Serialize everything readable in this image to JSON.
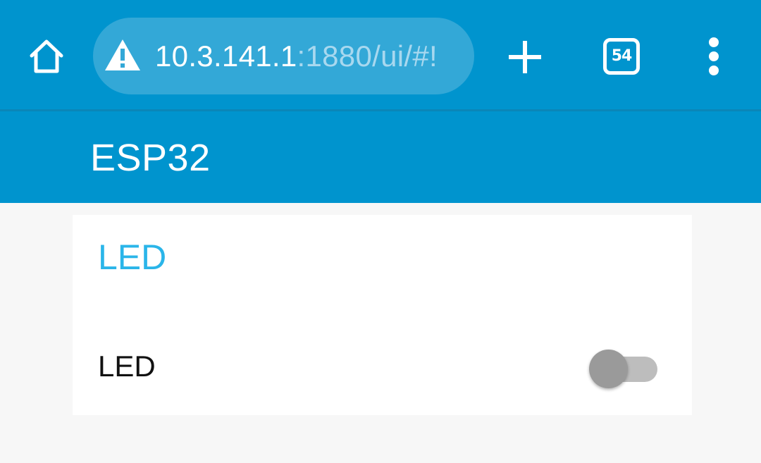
{
  "browser": {
    "url_host": "10.3.141.1",
    "url_rest": ":1880/ui/#!",
    "tab_count": "54",
    "icons": {
      "home": "home-icon",
      "warning": "warning-triangle-icon",
      "new_tab": "plus-icon",
      "tabs": "tab-switcher-icon",
      "menu": "overflow-menu-icon"
    },
    "colors": {
      "bar": "#0094ce",
      "url_pill": "#33a8d7",
      "url_rest_text": "#a8d8ef"
    }
  },
  "app": {
    "title": "ESP32"
  },
  "card": {
    "title": "LED",
    "title_color": "#2ab5e9",
    "switch": {
      "label": "LED",
      "state": "off"
    }
  }
}
